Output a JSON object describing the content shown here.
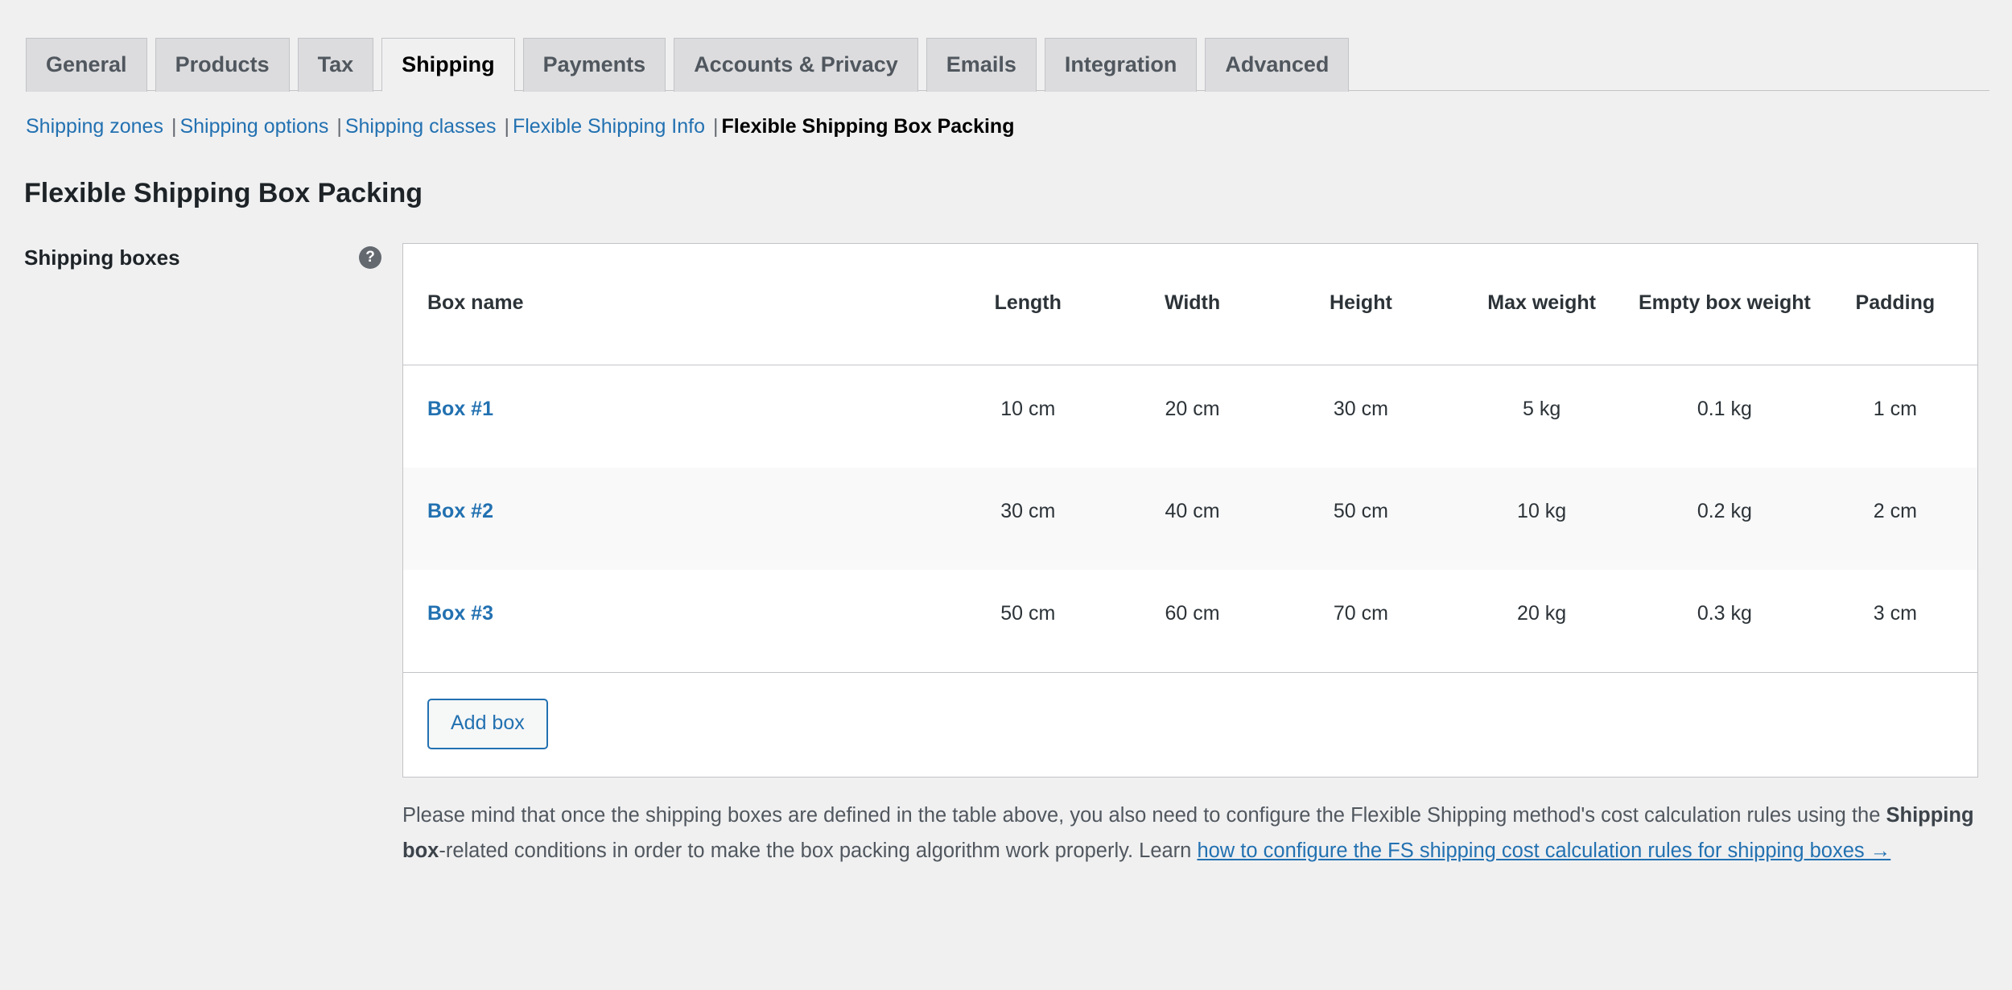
{
  "tabs": [
    {
      "label": "General",
      "active": false
    },
    {
      "label": "Products",
      "active": false
    },
    {
      "label": "Tax",
      "active": false
    },
    {
      "label": "Shipping",
      "active": true
    },
    {
      "label": "Payments",
      "active": false
    },
    {
      "label": "Accounts & Privacy",
      "active": false
    },
    {
      "label": "Emails",
      "active": false
    },
    {
      "label": "Integration",
      "active": false
    },
    {
      "label": "Advanced",
      "active": false
    }
  ],
  "subnav": {
    "separator": "|",
    "items": [
      {
        "label": "Shipping zones",
        "current": false
      },
      {
        "label": "Shipping options",
        "current": false
      },
      {
        "label": "Shipping classes",
        "current": false
      },
      {
        "label": "Flexible Shipping Info",
        "current": false
      },
      {
        "label": "Flexible Shipping Box Packing",
        "current": true
      }
    ]
  },
  "page": {
    "title": "Flexible Shipping Box Packing"
  },
  "field": {
    "label": "Shipping boxes",
    "help_icon": "question-mark-icon",
    "help_icon_glyph": "?"
  },
  "table": {
    "columns": [
      "Box name",
      "Length",
      "Width",
      "Height",
      "Max weight",
      "Empty box weight",
      "Padding"
    ],
    "rows": [
      {
        "name": "Box #1",
        "length": "10 cm",
        "width": "20 cm",
        "height": "30 cm",
        "max_weight": "5 kg",
        "empty_box_weight": "0.1 kg",
        "padding": "1 cm"
      },
      {
        "name": "Box #2",
        "length": "30 cm",
        "width": "40 cm",
        "height": "50 cm",
        "max_weight": "10 kg",
        "empty_box_weight": "0.2 kg",
        "padding": "2 cm"
      },
      {
        "name": "Box #3",
        "length": "50 cm",
        "width": "60 cm",
        "height": "70 cm",
        "max_weight": "20 kg",
        "empty_box_weight": "0.3 kg",
        "padding": "3 cm"
      }
    ],
    "add_button_label": "Add box"
  },
  "description": {
    "part1": "Please mind that once the shipping boxes are defined in the table above, you also need to configure the Flexible Shipping method's cost calculation rules using the ",
    "bold": "Shipping box",
    "part2": "-related conditions in order to make the box packing algorithm work properly. Learn ",
    "link": "how to configure the FS shipping cost calculation rules for shipping boxes →"
  },
  "colors": {
    "link": "#2271b1",
    "text": "#1d2327",
    "muted": "#50575e",
    "background": "#f0f0f1",
    "panel": "#ffffff",
    "border": "#c3c4c7",
    "stripe": "#f9f9f9",
    "help_icon_bg": "#646970"
  }
}
